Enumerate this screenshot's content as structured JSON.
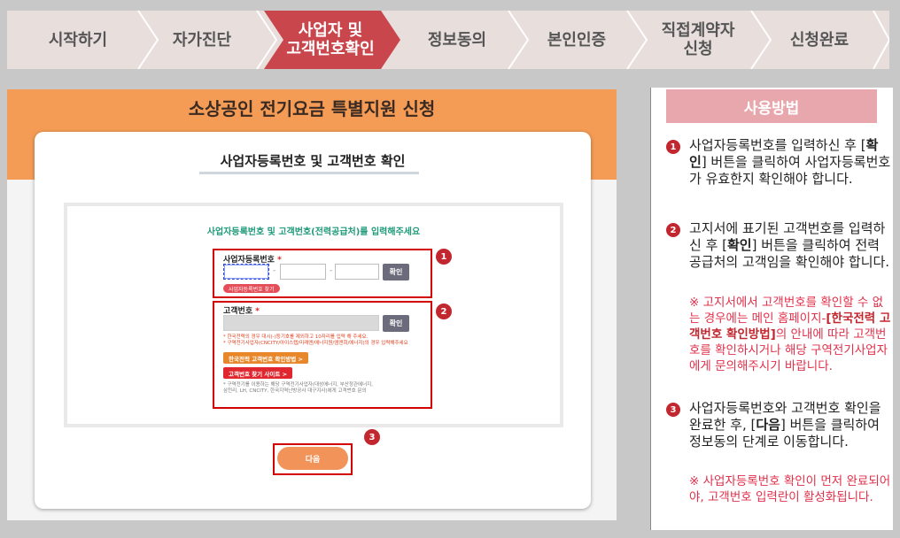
{
  "steps": [
    {
      "label": "시작하기",
      "active": false
    },
    {
      "label": "자가진단",
      "active": false
    },
    {
      "label": "사업자 및\n고객번호확인",
      "active": true
    },
    {
      "label": "정보동의",
      "active": false
    },
    {
      "label": "본인인증",
      "active": false
    },
    {
      "label": "직접계약자\n신청",
      "active": false
    },
    {
      "label": "신청완료",
      "active": false
    }
  ],
  "main": {
    "title": "소상공인 전기요금 특별지원 신청",
    "card_title": "사업자등록번호 및 고객번호 확인",
    "instruction": "사업자등록번호 및 고객번호(전력공급처)를 입력해주세요",
    "biz": {
      "label": "사업자등록번호",
      "required": "*",
      "separator": "-",
      "confirm": "확인",
      "find": "사업자등록번호 찾기"
    },
    "customer": {
      "label": "고객번호",
      "required": "*",
      "confirm": "확인",
      "note1": "* 한국전력의 경우 대시(-)등기호를 제외하고 10자리를 입력 해 주세요.",
      "note2": "* 구역전기사업자(CNCITY/아이스텝/미래엔/에너지원/엠앤회/에너지)의 경우 입력해주세요",
      "btn_kepco": "한국전력 고객번호 확인방법  >",
      "btn_find": "고객번호 찾기 사이트  >",
      "note3": "* 구역전기를 이용하는 해당 구역전기사업자(대성에너지, 부산정관에너지,",
      "note4": "삼천리, LH, CNCITY, 한국지역난방공사 대구지사)에게 고객번호 문의"
    },
    "badges": [
      "1",
      "2",
      "3"
    ],
    "next": "다음"
  },
  "side": {
    "title": "사용방법",
    "items": [
      {
        "num": "1",
        "pre": "사업자등록번호를 입력하신 후 [",
        "bold": "확인",
        "post": "] 버튼을 클릭하여 사업자등록번호가 유효한지 확인해야 합니다."
      },
      {
        "num": "2",
        "pre": "고지서에 표기된 고객번호를 입력하신 후 [",
        "bold": "확인",
        "post": "] 버튼을 클릭하여 전력공급처의 고객임을 확인해야 합니다.",
        "note_pre": "※ 고지서에서 고객번호를 확인할 수 없는 경우에는 메인 홈페이지-",
        "note_bold": "[한국전력 고객번호 확인방법]",
        "note_post": "의 안내에 따라 고객번호를 확인하시거나 해당 구역전기사업자에게 문의해주시기 바랍니다."
      },
      {
        "num": "3",
        "pre": "사업자등록번호와 고객번호 확인을 완료한 후, [",
        "bold": "다음",
        "post": "] 버튼을 클릭하여 정보동의 단계로 이동합니다.",
        "note": "※ 사업자등록번호 확인이 먼저 완료되어야, 고객번호 입력란이 활성화됩니다."
      }
    ]
  },
  "colors": {
    "active_step": "#c9464d",
    "orange": "#f49c56",
    "accent_red": "#c2262e",
    "pink_header": "#e8a7ac"
  }
}
